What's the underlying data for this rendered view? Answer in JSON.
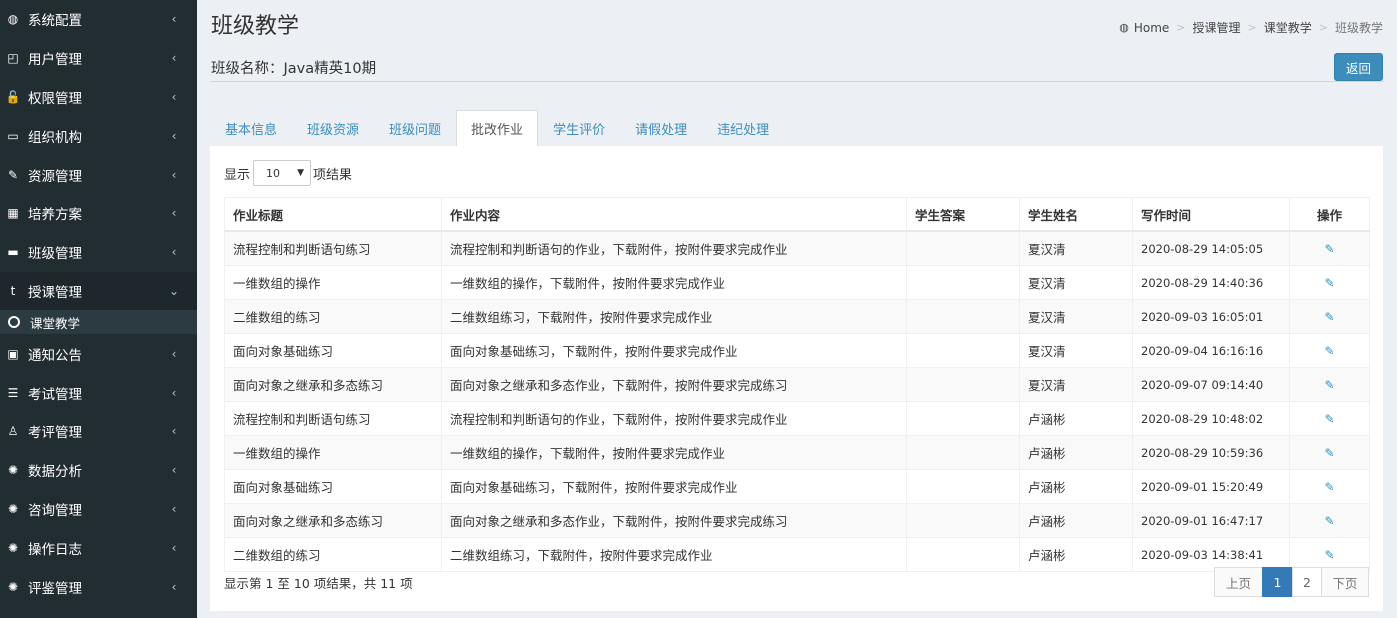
{
  "sidebar": {
    "items": [
      {
        "label": "系统配置",
        "icon": "dashboard-icon",
        "glyph": "◍"
      },
      {
        "label": "用户管理",
        "icon": "users-icon",
        "glyph": "◰"
      },
      {
        "label": "权限管理",
        "icon": "unlock-icon",
        "glyph": "🔓"
      },
      {
        "label": "组织机构",
        "icon": "laptop-icon",
        "glyph": "▭"
      },
      {
        "label": "资源管理",
        "icon": "edit-icon",
        "glyph": "✎"
      },
      {
        "label": "培养方案",
        "icon": "table-icon",
        "glyph": "▦"
      },
      {
        "label": "班级管理",
        "icon": "folder-icon",
        "glyph": "▬"
      },
      {
        "label": "授课管理",
        "icon": "tumblr-icon",
        "glyph": "t",
        "active": true
      },
      {
        "label": "通知公告",
        "icon": "vimeo-icon",
        "glyph": "▣"
      },
      {
        "label": "考试管理",
        "icon": "list-icon",
        "glyph": "☰"
      },
      {
        "label": "考评管理",
        "icon": "male-icon",
        "glyph": "♙"
      },
      {
        "label": "数据分析",
        "icon": "support-icon",
        "glyph": "✺"
      },
      {
        "label": "咨询管理",
        "icon": "support-icon",
        "glyph": "✺"
      },
      {
        "label": "操作日志",
        "icon": "support-icon",
        "glyph": "✺"
      },
      {
        "label": "评鉴管理",
        "icon": "support-icon",
        "glyph": "✺"
      },
      {
        "label": "",
        "icon": "support-icon",
        "glyph": "✺"
      }
    ],
    "sub_item": "课堂教学"
  },
  "header": {
    "title": "班级教学",
    "breadcrumb": [
      "Home",
      "授课管理",
      "课堂教学",
      "班级教学"
    ]
  },
  "class_info": {
    "label": "班级名称：",
    "name": "Java精英10期",
    "back_label": "返回"
  },
  "tabs": [
    "基本信息",
    "班级资源",
    "班级问题",
    "批改作业",
    "学生评价",
    "请假处理",
    "违纪处理"
  ],
  "active_tab": 3,
  "length": {
    "prefix": "显示",
    "value": "10",
    "suffix": "项结果"
  },
  "table": {
    "columns": [
      "作业标题",
      "作业内容",
      "学生答案",
      "学生姓名",
      "写作时间",
      "操作"
    ],
    "rows": [
      [
        "流程控制和判断语句练习",
        "流程控制和判断语句的作业，下载附件，按附件要求完成作业",
        "",
        "夏汉清",
        "2020-08-29 14:05:05"
      ],
      [
        "一维数组的操作",
        "一维数组的操作，下载附件，按附件要求完成作业",
        "",
        "夏汉清",
        "2020-08-29 14:40:36"
      ],
      [
        "二维数组的练习",
        "二维数组练习，下载附件，按附件要求完成作业",
        "",
        "夏汉清",
        "2020-09-03 16:05:01"
      ],
      [
        "面向对象基础练习",
        "面向对象基础练习，下载附件，按附件要求完成作业",
        "",
        "夏汉清",
        "2020-09-04 16:16:16"
      ],
      [
        "面向对象之继承和多态练习",
        "面向对象之继承和多态作业，下载附件，按附件要求完成练习",
        "",
        "夏汉清",
        "2020-09-07 09:14:40"
      ],
      [
        "流程控制和判断语句练习",
        "流程控制和判断语句的作业，下载附件，按附件要求完成作业",
        "",
        "卢涵彬",
        "2020-08-29 10:48:02"
      ],
      [
        "一维数组的操作",
        "一维数组的操作，下载附件，按附件要求完成作业",
        "",
        "卢涵彬",
        "2020-08-29 10:59:36"
      ],
      [
        "面向对象基础练习",
        "面向对象基础练习，下载附件，按附件要求完成作业",
        "",
        "卢涵彬",
        "2020-09-01 15:20:49"
      ],
      [
        "面向对象之继承和多态练习",
        "面向对象之继承和多态作业，下载附件，按附件要求完成练习",
        "",
        "卢涵彬",
        "2020-09-01 16:47:17"
      ],
      [
        "二维数组的练习",
        "二维数组练习，下载附件，按附件要求完成作业",
        "",
        "卢涵彬",
        "2020-09-03 14:38:41"
      ]
    ]
  },
  "footer": {
    "info": "显示第 1 至 10 项结果，共 11 项",
    "pager": {
      "prev": "上页",
      "pages": [
        "1",
        "2"
      ],
      "current": "1",
      "next": "下页"
    }
  },
  "colors": {
    "sidebar_bg": "#222d32",
    "accent": "#3c8dbc",
    "page_bg": "#ecf0f5"
  }
}
